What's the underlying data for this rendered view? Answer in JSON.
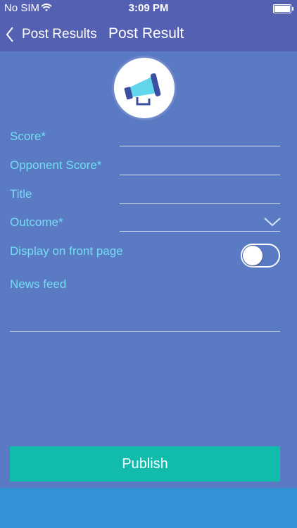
{
  "status_bar": {
    "carrier": "No SIM",
    "time": "3:09 PM"
  },
  "nav": {
    "back_label": "Post Results",
    "title": "Post Result"
  },
  "form": {
    "score_label": "Score*",
    "opponent_score_label": "Opponent Score*",
    "title_label": "Title",
    "outcome_label": "Outcome*",
    "display_front_page_label": "Display on front page",
    "display_front_page_on": false,
    "news_feed_label": "News feed"
  },
  "publish_label": "Publish",
  "colors": {
    "nav_background": "#5460b2",
    "page_background": "#5a7ac3",
    "label": "#73ddf3",
    "publish_button": "#12bcad",
    "bottom_bar": "#3393d6"
  }
}
